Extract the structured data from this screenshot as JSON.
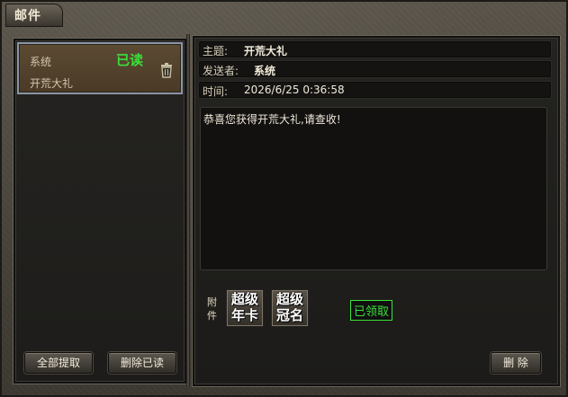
{
  "window": {
    "title": "邮件"
  },
  "mail_list": [
    {
      "sender": "系统",
      "status": "已读",
      "subject": "开荒大礼"
    }
  ],
  "detail": {
    "subject_label": "主题:",
    "subject": "开荒大礼",
    "sender_label": "发送者:",
    "sender": "系统",
    "time_label": "时间:",
    "time": "2026/6/25 0:36:58",
    "body": "恭喜您获得开荒大礼,请查收!",
    "attachments_label": "附件",
    "attachments": [
      {
        "line1": "超级",
        "line2": "年卡"
      },
      {
        "line1": "超级",
        "line2": "冠名"
      }
    ],
    "claimed_label": "已领取"
  },
  "buttons": {
    "extract_all": "全部提取",
    "delete_read": "删除已读",
    "delete": "删 除"
  },
  "colors": {
    "accent_green": "#3be03b",
    "frame": "#4a463e"
  }
}
